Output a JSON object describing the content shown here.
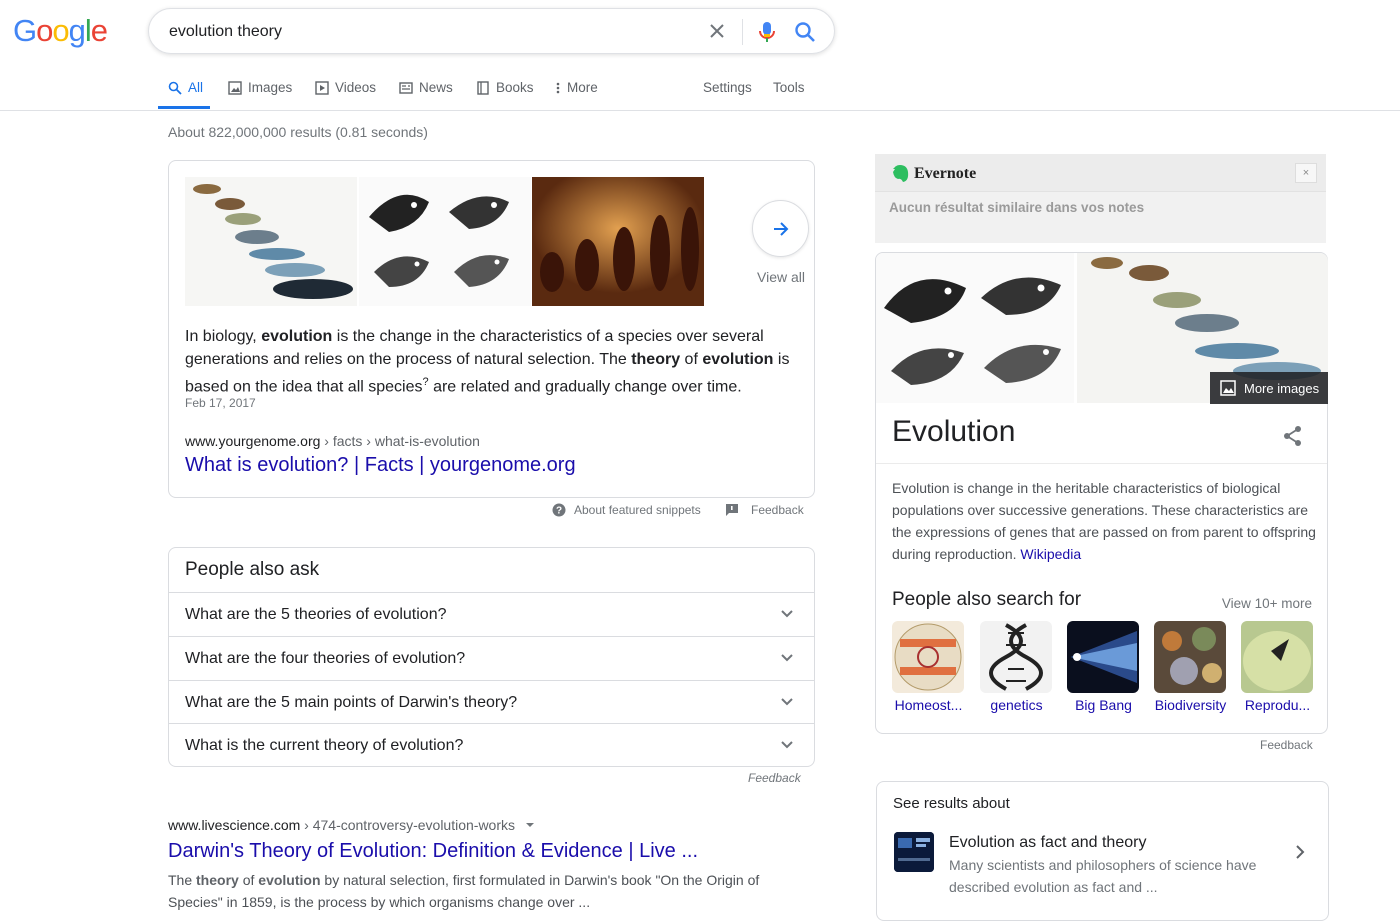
{
  "header": {
    "logo_letters": [
      {
        "ch": "G",
        "color": "#4285f4"
      },
      {
        "ch": "o",
        "color": "#ea4335"
      },
      {
        "ch": "o",
        "color": "#fbbc05"
      },
      {
        "ch": "g",
        "color": "#4285f4"
      },
      {
        "ch": "l",
        "color": "#34a853"
      },
      {
        "ch": "e",
        "color": "#ea4335"
      }
    ],
    "query": "evolution theory",
    "tabs": [
      "All",
      "Images",
      "Videos",
      "News",
      "Books",
      "More"
    ],
    "settings": "Settings",
    "tools": "Tools"
  },
  "stats": "About 822,000,000 results (0.81 seconds)",
  "featured": {
    "view_all": "View all",
    "snippet_parts": {
      "a": "In biology, ",
      "b": "evolution",
      "c": " is the change in the characteristics of a species over several generations and relies on the process of natural selection. The ",
      "d": "theory",
      "e": " of ",
      "f": "evolution",
      "g": " is based on the idea that all species",
      "sup": "?",
      "h": " are related and gradually change over time."
    },
    "date": "Feb 17, 2017",
    "cite_domain": "www.yourgenome.org",
    "cite_path": " › facts › what-is-evolution",
    "title": "What is evolution? | Facts | yourgenome.org",
    "about": "About featured snippets",
    "feedback": "Feedback"
  },
  "paa": {
    "title": "People also ask",
    "questions": [
      "What are the 5 theories of evolution?",
      "What are the four theories of evolution?",
      "What are the 5 main points of Darwin's theory?",
      "What is the current theory of evolution?"
    ],
    "feedback": "Feedback"
  },
  "result": {
    "cite_domain": "www.livescience.com",
    "cite_path": " › 474-controversy-evolution-works",
    "title": "Darwin's Theory of Evolution: Definition & Evidence | Live ...",
    "snip_a": "The ",
    "snip_b": "theory",
    "snip_c": " of ",
    "snip_d": "evolution",
    "snip_e": " by natural selection, first formulated in Darwin's book \"On the Origin of Species\" in 1859, is the process by which organisms change over ..."
  },
  "evernote": {
    "name": "Evernote",
    "close": "×",
    "message": "Aucun résultat similaire dans vos notes"
  },
  "knowledge": {
    "more_images": "More images",
    "title": "Evolution",
    "description": "Evolution is change in the heritable characteristics of biological populations over successive generations. These characteristics are the expressions of genes that are passed on from parent to offspring during reproduction.",
    "source": "Wikipedia",
    "pasf_title": "People also search for",
    "view_more": "View 10+ more",
    "pasf": [
      "Homeost...",
      "genetics",
      "Big Bang",
      "Biodiversity",
      "Reprodu..."
    ],
    "feedback": "Feedback"
  },
  "see_results": {
    "title": "See results about",
    "item_title": "Evolution as fact and theory",
    "item_desc": "Many scientists and philosophers of science have described evolution as fact and ..."
  },
  "colors": {
    "link": "#1a0dab",
    "accent": "#1a73e8",
    "evernote_green": "#2dbe60"
  }
}
